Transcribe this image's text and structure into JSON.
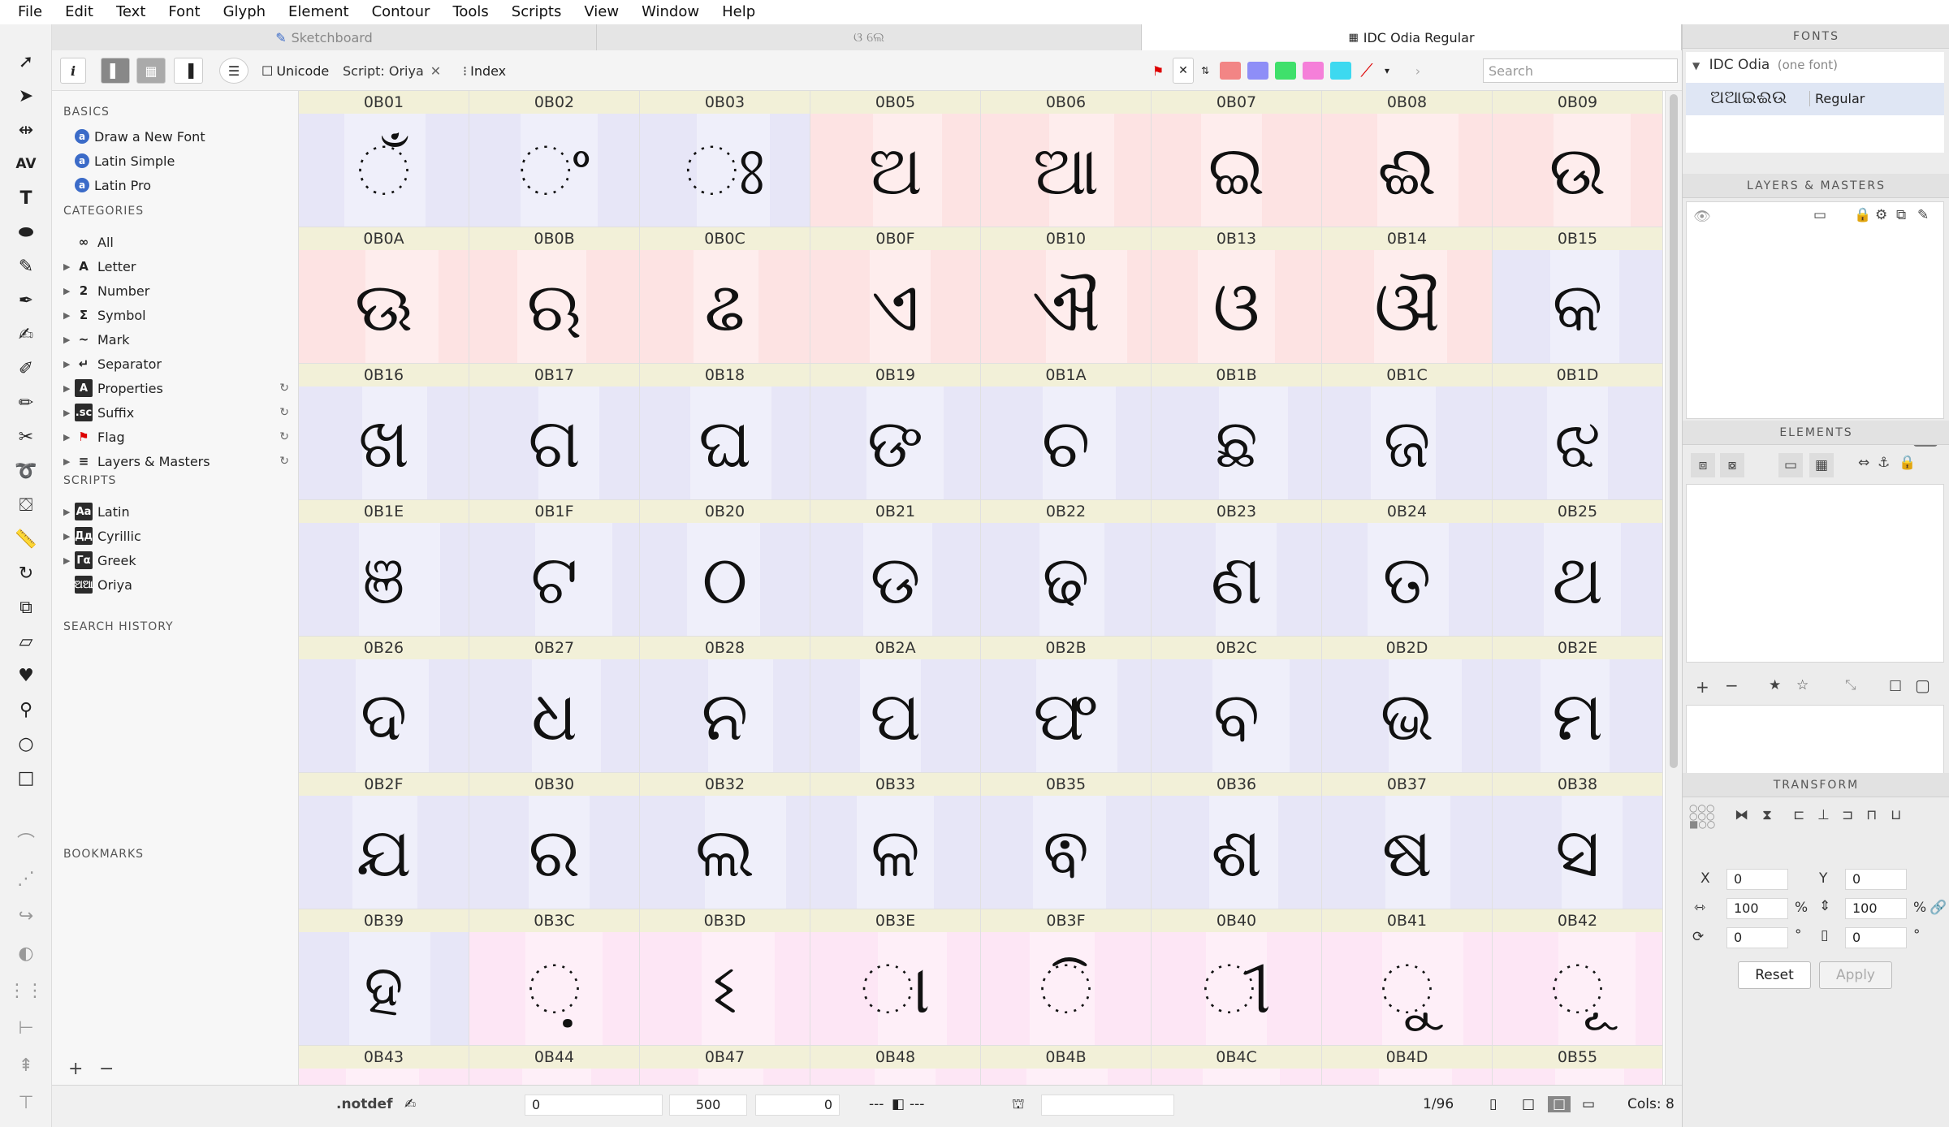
{
  "menu": [
    "File",
    "Edit",
    "Text",
    "Font",
    "Glyph",
    "Element",
    "Contour",
    "Tools",
    "Scripts",
    "View",
    "Window",
    "Help"
  ],
  "tabs": [
    {
      "label": "Sketchboard",
      "active": false
    },
    {
      "label": "ଓ ଲେ",
      "active": false
    },
    {
      "label": "IDC Odia Regular",
      "active": true
    }
  ],
  "toolbar": {
    "info_label": "i",
    "unicode_label": "Unicode",
    "script_label": "Script: Oriya",
    "index_label": "Index",
    "search_placeholder": "Search",
    "flag_colors": [
      "#f28585",
      "#8e8ef7",
      "#3fe06b",
      "#f57fd9",
      "#3dd9f0"
    ]
  },
  "sidebar": {
    "basics_header": "BASICS",
    "basics": [
      "Draw a New Font",
      "Latin Simple",
      "Latin Pro"
    ],
    "categories_header": "CATEGORIES",
    "categories": [
      {
        "icon": "∞",
        "label": "All",
        "arrow": false,
        "gear": false
      },
      {
        "icon": "A",
        "label": "Letter",
        "arrow": true,
        "gear": false
      },
      {
        "icon": "2",
        "label": "Number",
        "arrow": true,
        "gear": false
      },
      {
        "icon": "Σ",
        "label": "Symbol",
        "arrow": true,
        "gear": false
      },
      {
        "icon": "~",
        "label": "Mark",
        "arrow": true,
        "gear": false
      },
      {
        "icon": "↵",
        "label": "Separator",
        "arrow": true,
        "gear": false
      },
      {
        "icon": "A",
        "label": "Properties",
        "arrow": true,
        "gear": true
      },
      {
        "icon": ".sc",
        "label": "Suffix",
        "arrow": true,
        "gear": true
      },
      {
        "icon": "⚑",
        "label": "Flag",
        "arrow": true,
        "gear": true
      },
      {
        "icon": "≡",
        "label": "Layers & Masters",
        "arrow": true,
        "gear": true
      }
    ],
    "scripts_header": "SCRIPTS",
    "scripts": [
      {
        "icon": "Aa",
        "label": "Latin"
      },
      {
        "icon": "Дд",
        "label": "Cyrillic"
      },
      {
        "icon": "Γα",
        "label": "Greek"
      },
      {
        "icon": "ଅଆ",
        "label": "Oriya"
      }
    ],
    "search_history_header": "SEARCH HISTORY",
    "bookmarks_header": "BOOKMARKS",
    "add_label": "+",
    "remove_label": "−"
  },
  "glyphs": [
    {
      "code": "0B01",
      "char": "ଁ",
      "bg": "#e7e6f7"
    },
    {
      "code": "0B02",
      "char": "ଂ",
      "bg": "#e7e6f7"
    },
    {
      "code": "0B03",
      "char": "ଃ",
      "bg": "#e7e6f7"
    },
    {
      "code": "0B05",
      "char": "ଅ",
      "bg": "#fde3e3"
    },
    {
      "code": "0B06",
      "char": "ଆ",
      "bg": "#fde3e3"
    },
    {
      "code": "0B07",
      "char": "ଇ",
      "bg": "#fde3e3"
    },
    {
      "code": "0B08",
      "char": "ଈ",
      "bg": "#fde3e3"
    },
    {
      "code": "0B09",
      "char": "ଉ",
      "bg": "#fde3e3"
    },
    {
      "code": "0B0A",
      "char": "ଊ",
      "bg": "#fde3e3"
    },
    {
      "code": "0B0B",
      "char": "ଋ",
      "bg": "#fde3e3"
    },
    {
      "code": "0B0C",
      "char": "ଌ",
      "bg": "#fde3e3"
    },
    {
      "code": "0B0F",
      "char": "ଏ",
      "bg": "#fde3e3"
    },
    {
      "code": "0B10",
      "char": "ଐ",
      "bg": "#fde3e3"
    },
    {
      "code": "0B13",
      "char": "ଓ",
      "bg": "#fde3e3"
    },
    {
      "code": "0B14",
      "char": "ଔ",
      "bg": "#fde3e3"
    },
    {
      "code": "0B15",
      "char": "କ",
      "bg": "#e7e6f7"
    },
    {
      "code": "0B16",
      "char": "ଖ",
      "bg": "#e7e6f7"
    },
    {
      "code": "0B17",
      "char": "ଗ",
      "bg": "#e7e6f7"
    },
    {
      "code": "0B18",
      "char": "ଘ",
      "bg": "#e7e6f7"
    },
    {
      "code": "0B19",
      "char": "ଙ",
      "bg": "#e7e6f7"
    },
    {
      "code": "0B1A",
      "char": "ଚ",
      "bg": "#e7e6f7"
    },
    {
      "code": "0B1B",
      "char": "ଛ",
      "bg": "#e7e6f7"
    },
    {
      "code": "0B1C",
      "char": "ଜ",
      "bg": "#e7e6f7"
    },
    {
      "code": "0B1D",
      "char": "ଝ",
      "bg": "#e7e6f7"
    },
    {
      "code": "0B1E",
      "char": "ଞ",
      "bg": "#e7e6f7"
    },
    {
      "code": "0B1F",
      "char": "ଟ",
      "bg": "#e7e6f7"
    },
    {
      "code": "0B20",
      "char": "ଠ",
      "bg": "#e7e6f7"
    },
    {
      "code": "0B21",
      "char": "ଡ",
      "bg": "#e7e6f7"
    },
    {
      "code": "0B22",
      "char": "ଢ",
      "bg": "#e7e6f7"
    },
    {
      "code": "0B23",
      "char": "ଣ",
      "bg": "#e7e6f7"
    },
    {
      "code": "0B24",
      "char": "ତ",
      "bg": "#e7e6f7"
    },
    {
      "code": "0B25",
      "char": "ଥ",
      "bg": "#e7e6f7"
    },
    {
      "code": "0B26",
      "char": "ଦ",
      "bg": "#e7e6f7"
    },
    {
      "code": "0B27",
      "char": "ଧ",
      "bg": "#e7e6f7"
    },
    {
      "code": "0B28",
      "char": "ନ",
      "bg": "#e7e6f7"
    },
    {
      "code": "0B2A",
      "char": "ପ",
      "bg": "#e7e6f7"
    },
    {
      "code": "0B2B",
      "char": "ଫ",
      "bg": "#e7e6f7"
    },
    {
      "code": "0B2C",
      "char": "ବ",
      "bg": "#e7e6f7"
    },
    {
      "code": "0B2D",
      "char": "ଭ",
      "bg": "#e7e6f7"
    },
    {
      "code": "0B2E",
      "char": "ମ",
      "bg": "#e7e6f7"
    },
    {
      "code": "0B2F",
      "char": "ଯ",
      "bg": "#e7e6f7"
    },
    {
      "code": "0B30",
      "char": "ର",
      "bg": "#e7e6f7"
    },
    {
      "code": "0B32",
      "char": "ଲ",
      "bg": "#e7e6f7"
    },
    {
      "code": "0B33",
      "char": "ଳ",
      "bg": "#e7e6f7"
    },
    {
      "code": "0B35",
      "char": "ଵ",
      "bg": "#e7e6f7"
    },
    {
      "code": "0B36",
      "char": "ଶ",
      "bg": "#e7e6f7"
    },
    {
      "code": "0B37",
      "char": "ଷ",
      "bg": "#e7e6f7"
    },
    {
      "code": "0B38",
      "char": "ସ",
      "bg": "#e7e6f7"
    },
    {
      "code": "0B39",
      "char": "ହ",
      "bg": "#e7e6f7"
    },
    {
      "code": "0B3C",
      "char": "଼",
      "bg": "#fde6f5"
    },
    {
      "code": "0B3D",
      "char": "ଽ",
      "bg": "#fde6f5"
    },
    {
      "code": "0B3E",
      "char": "ା",
      "bg": "#fde6f5"
    },
    {
      "code": "0B3F",
      "char": "ି",
      "bg": "#fde6f5"
    },
    {
      "code": "0B40",
      "char": "ୀ",
      "bg": "#fde6f5"
    },
    {
      "code": "0B41",
      "char": "ୁ",
      "bg": "#fde6f5"
    },
    {
      "code": "0B42",
      "char": "ୂ",
      "bg": "#fde6f5"
    },
    {
      "code": "0B43",
      "char": "ୃ",
      "bg": "#fde6f5"
    },
    {
      "code": "0B44",
      "char": "ୄ",
      "bg": "#fde6f5"
    },
    {
      "code": "0B47",
      "char": "େ",
      "bg": "#fde6f5"
    },
    {
      "code": "0B48",
      "char": "ୈ",
      "bg": "#fde6f5"
    },
    {
      "code": "0B4B",
      "char": "ୋ",
      "bg": "#fde6f5"
    },
    {
      "code": "0B4C",
      "char": "ୌ",
      "bg": "#fde6f5"
    },
    {
      "code": "0B4D",
      "char": "୍",
      "bg": "#fde6f5"
    },
    {
      "code": "0B55",
      "char": "୕",
      "bg": "#fde6f5"
    }
  ],
  "fonts_panel": {
    "header": "FONTS",
    "family": "IDC Odia",
    "count": "(one font)",
    "sample": "ଅଆଇଈଉ",
    "style": "Regular"
  },
  "layers_header": "LAYERS & MASTERS",
  "elements_header": "ELEMENTS",
  "transform": {
    "header": "TRANSFORM",
    "x_label": "X",
    "x": "0",
    "y_label": "Y",
    "y": "0",
    "w": "100",
    "h": "100",
    "pct": "%",
    "rot": "0",
    "deg": "°",
    "skew": "0",
    "reset_label": "Reset",
    "apply_label": "Apply"
  },
  "status": {
    "glyph_name": ".notdef",
    "lsb": "0",
    "width": "500",
    "rsb": "0",
    "dash_left": "---",
    "dash_right": "---",
    "page": "1/96",
    "cols": "Cols: 8"
  }
}
